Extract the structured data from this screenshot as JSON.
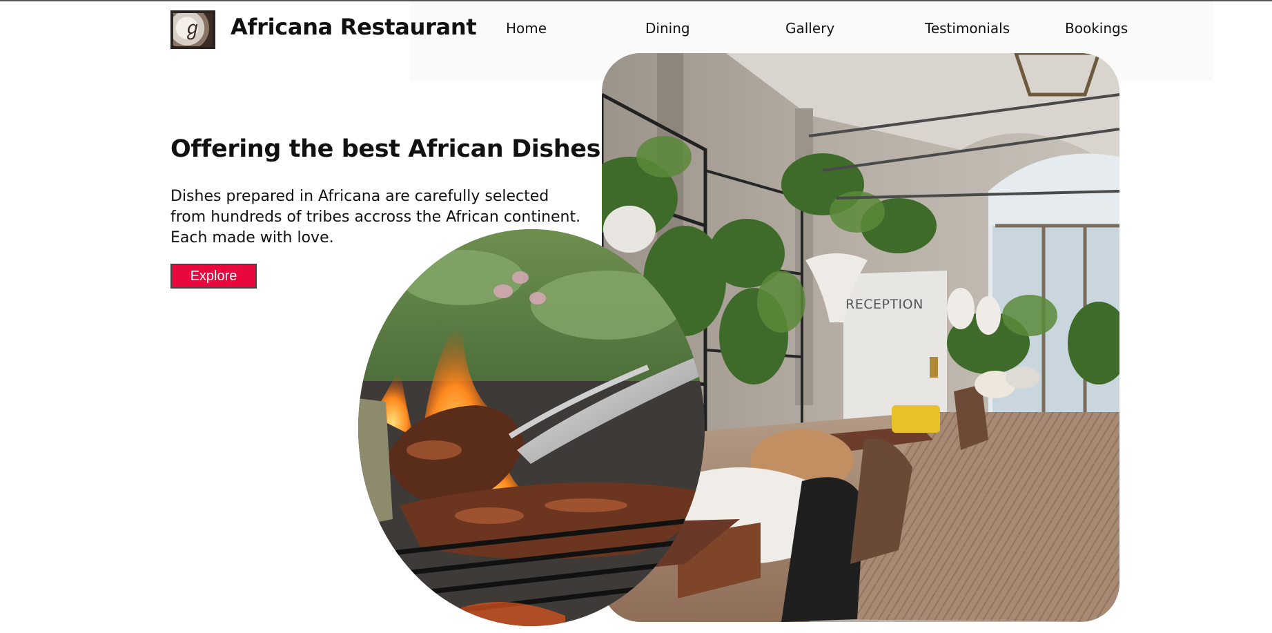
{
  "brand": {
    "name": "Africana Restaurant",
    "logo_icon": "restaurant-logo-icon"
  },
  "nav": {
    "items": [
      {
        "label": "Home"
      },
      {
        "label": "Dining"
      },
      {
        "label": "Gallery"
      },
      {
        "label": "Testimonials"
      },
      {
        "label": "Bookings"
      }
    ]
  },
  "hero": {
    "headline": "Offering the best African Dishes",
    "lead_lines": [
      "Dishes prepared in Africana are carefully selected",
      "from hundreds of tribes accross the African continent.",
      "Each made with love."
    ],
    "cta_label": "Explore"
  },
  "images": {
    "interior": {
      "sign_text": "RECEPTION"
    }
  },
  "colors": {
    "accent": "#e8083e",
    "text": "#111111",
    "background": "#ffffff",
    "nav_band": "#fafafa"
  }
}
